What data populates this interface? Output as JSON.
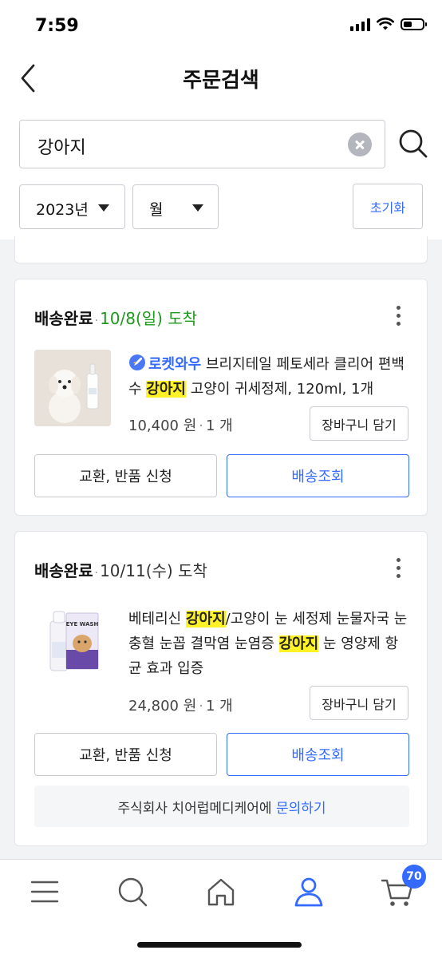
{
  "status_bar": {
    "time": "7:59"
  },
  "header": {
    "title": "주문검색"
  },
  "search": {
    "value": "강아지"
  },
  "filters": {
    "year": "2023년",
    "month": "월",
    "reset_label": "초기화"
  },
  "orders": [
    {
      "status": "배송완료",
      "date": "10/8(일) 도착",
      "product": {
        "badge": "로켓와우",
        "name_before": "브리지테일 페토세라 클리어 편백수 ",
        "highlight": "강아지",
        "name_after": " 고양이 귀세정제, 120ml, 1개"
      },
      "price": "10,400 원",
      "qty": "1 개",
      "add_to_cart": "장바구니 담기",
      "exchange_label": "교환, 반품 신청",
      "tracking_label": "배송조회"
    },
    {
      "status": "배송완료",
      "date": "10/11(수) 도착",
      "product": {
        "part1": "베테리신 ",
        "hl1": "강아지",
        "part2": "/고양이 눈 세정제 눈물자국 눈충혈 눈꼽 결막염 눈염증 ",
        "hl2": "강아지",
        "part3": " 눈 영양제 항균 효과 입증",
        "pack_text": "EYE WASH"
      },
      "price": "24,800 원",
      "qty": "1 개",
      "add_to_cart": "장바구니 담기",
      "exchange_label": "교환, 반품 신청",
      "tracking_label": "배송조회",
      "inquiry_seller": "주식회사 치어럽메디케어에 ",
      "inquiry_link": "문의하기"
    }
  ],
  "bottom_nav": {
    "cart_count": "70"
  },
  "colors": {
    "accent": "#346aff",
    "arrival_green": "#1b9a1b",
    "highlight": "#fff226"
  }
}
